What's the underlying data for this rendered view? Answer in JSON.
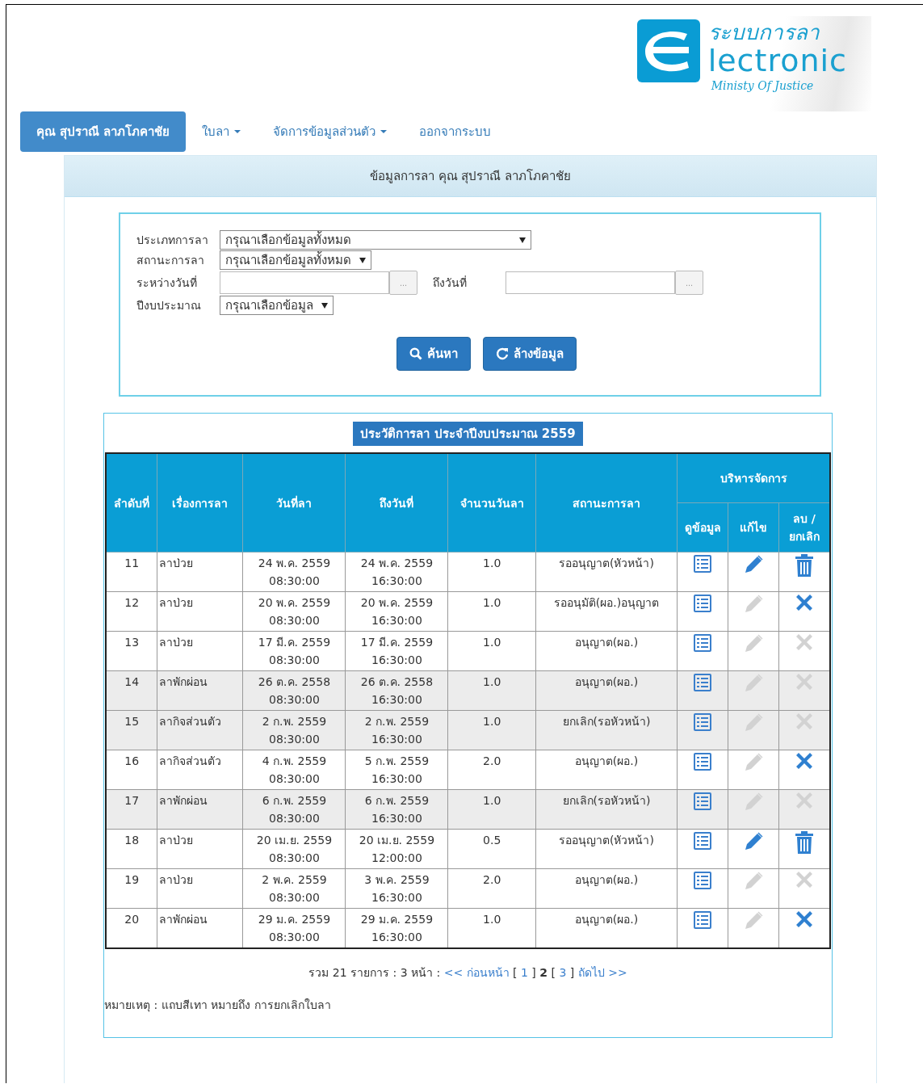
{
  "logo": {
    "title": "ระบบการลา",
    "word": "lectronic",
    "subtitle": "Ministy Of Justice"
  },
  "nav": [
    {
      "label": "คุณ สุปราณี ลาภโภคาชัย",
      "selected": true,
      "dropdown": false
    },
    {
      "label": "ใบลา",
      "selected": false,
      "dropdown": true
    },
    {
      "label": "จัดการข้อมูลส่วนตัว",
      "selected": false,
      "dropdown": true
    },
    {
      "label": "ออกจากระบบ",
      "selected": false,
      "dropdown": false
    }
  ],
  "panel_title": "ข้อมูลการลา คุณ สุปราณี ลาภโภคาชัย",
  "filters": [
    {
      "kind": "select",
      "label": "ประเภทการลา",
      "value": "กรุณาเลือกข้อมูลทั้งหมด",
      "wide": true
    },
    {
      "kind": "select",
      "label": "สถานะการลา",
      "value": "กรุณาเลือกข้อมูลทั้งหมด",
      "wide": false
    },
    {
      "kind": "daterange",
      "label": "ระหว่างวันที่",
      "picker": "...",
      "label2": "ถึงวันที่",
      "picker2": "..."
    },
    {
      "kind": "select",
      "label": "ปีงบประมาณ",
      "value": "กรุณาเลือกข้อมูล",
      "wide": false
    }
  ],
  "buttons": [
    {
      "kind": "search",
      "label": "ค้นหา"
    },
    {
      "kind": "reset",
      "label": "ล้างข้อมูล"
    }
  ],
  "table_title": "ประวัติการลา ประจำปีงบประมาณ 2559",
  "columns": [
    "ลำดับที่",
    "เรื่องการลา",
    "วันที่ลา",
    "ถึงวันที่",
    "จำนวนวันลา",
    "สถานะการลา"
  ],
  "manage": {
    "title": "บริหารจัดการ",
    "columns": [
      "ดูข้อมูล",
      "แก้ไข",
      "ลบ / ยกเลิก"
    ]
  },
  "rows": [
    {
      "no": "11",
      "type": "ลาป่วย",
      "from_date": "24 พ.ค. 2559",
      "from_time": "08:30:00",
      "to_date": "24 พ.ค. 2559",
      "to_time": "16:30:00",
      "days": "1.0",
      "status": "รออนุญาต(หัวหน้า)",
      "cancelled": false,
      "edit_enabled": true,
      "delete": {
        "kind": "trash",
        "enabled": true
      }
    },
    {
      "no": "12",
      "type": "ลาป่วย",
      "from_date": "20 พ.ค. 2559",
      "from_time": "08:30:00",
      "to_date": "20 พ.ค. 2559",
      "to_time": "16:30:00",
      "days": "1.0",
      "status": "รออนุมัติ(ผอ.)อนุญาต",
      "cancelled": false,
      "edit_enabled": false,
      "delete": {
        "kind": "cross",
        "enabled": true
      }
    },
    {
      "no": "13",
      "type": "ลาป่วย",
      "from_date": "17 มี.ค. 2559",
      "from_time": "08:30:00",
      "to_date": "17 มี.ค. 2559",
      "to_time": "16:30:00",
      "days": "1.0",
      "status": "อนุญาต(ผอ.)",
      "cancelled": false,
      "edit_enabled": false,
      "delete": {
        "kind": "cross",
        "enabled": false
      }
    },
    {
      "no": "14",
      "type": "ลาพักผ่อน",
      "from_date": "26 ต.ค. 2558",
      "from_time": "08:30:00",
      "to_date": "26 ต.ค. 2558",
      "to_time": "16:30:00",
      "days": "1.0",
      "status": "อนุญาต(ผอ.)",
      "cancelled": true,
      "edit_enabled": false,
      "delete": {
        "kind": "cross",
        "enabled": false
      }
    },
    {
      "no": "15",
      "type": "ลากิจส่วนตัว",
      "from_date": "2 ก.พ. 2559",
      "from_time": "08:30:00",
      "to_date": "2 ก.พ. 2559",
      "to_time": "16:30:00",
      "days": "1.0",
      "status": "ยกเลิก(รอหัวหน้า)",
      "cancelled": true,
      "edit_enabled": false,
      "delete": {
        "kind": "cross",
        "enabled": false
      }
    },
    {
      "no": "16",
      "type": "ลากิจส่วนตัว",
      "from_date": "4 ก.พ. 2559",
      "from_time": "08:30:00",
      "to_date": "5 ก.พ. 2559",
      "to_time": "16:30:00",
      "days": "2.0",
      "status": "อนุญาต(ผอ.)",
      "cancelled": false,
      "edit_enabled": false,
      "delete": {
        "kind": "cross",
        "enabled": true
      }
    },
    {
      "no": "17",
      "type": "ลาพักผ่อน",
      "from_date": "6 ก.พ. 2559",
      "from_time": "08:30:00",
      "to_date": "6 ก.พ. 2559",
      "to_time": "16:30:00",
      "days": "1.0",
      "status": "ยกเลิก(รอหัวหน้า)",
      "cancelled": true,
      "edit_enabled": false,
      "delete": {
        "kind": "cross",
        "enabled": false
      }
    },
    {
      "no": "18",
      "type": "ลาป่วย",
      "from_date": "20 เม.ย. 2559",
      "from_time": "08:30:00",
      "to_date": "20 เม.ย. 2559",
      "to_time": "12:00:00",
      "days": "0.5",
      "status": "รออนุญาต(หัวหน้า)",
      "cancelled": false,
      "edit_enabled": true,
      "delete": {
        "kind": "trash",
        "enabled": true
      }
    },
    {
      "no": "19",
      "type": "ลาป่วย",
      "from_date": "2 พ.ค. 2559",
      "from_time": "08:30:00",
      "to_date": "3 พ.ค. 2559",
      "to_time": "16:30:00",
      "days": "2.0",
      "status": "อนุญาต(ผอ.)",
      "cancelled": false,
      "edit_enabled": false,
      "delete": {
        "kind": "cross",
        "enabled": false
      }
    },
    {
      "no": "20",
      "type": "ลาพักผ่อน",
      "from_date": "29 ม.ค. 2559",
      "from_time": "08:30:00",
      "to_date": "29 ม.ค. 2559",
      "to_time": "16:30:00",
      "days": "1.0",
      "status": "อนุญาต(ผอ.)",
      "cancelled": false,
      "edit_enabled": false,
      "delete": {
        "kind": "cross",
        "enabled": true
      }
    }
  ],
  "pager": [
    {
      "kind": "text",
      "text": "รวม 21 รายการ : 3 หน้า :"
    },
    {
      "kind": "link",
      "text": "<< ก่อนหน้า"
    },
    {
      "kind": "text",
      "text": "["
    },
    {
      "kind": "link",
      "text": "1"
    },
    {
      "kind": "text",
      "text": "]"
    },
    {
      "kind": "current",
      "text": "2"
    },
    {
      "kind": "text",
      "text": "["
    },
    {
      "kind": "link",
      "text": "3"
    },
    {
      "kind": "text",
      "text": "]"
    },
    {
      "kind": "link",
      "text": "ถัดไป >>"
    }
  ],
  "note": "หมายเหตุ : แถบสีเทา หมายถึง การยกเลิกใบลา"
}
